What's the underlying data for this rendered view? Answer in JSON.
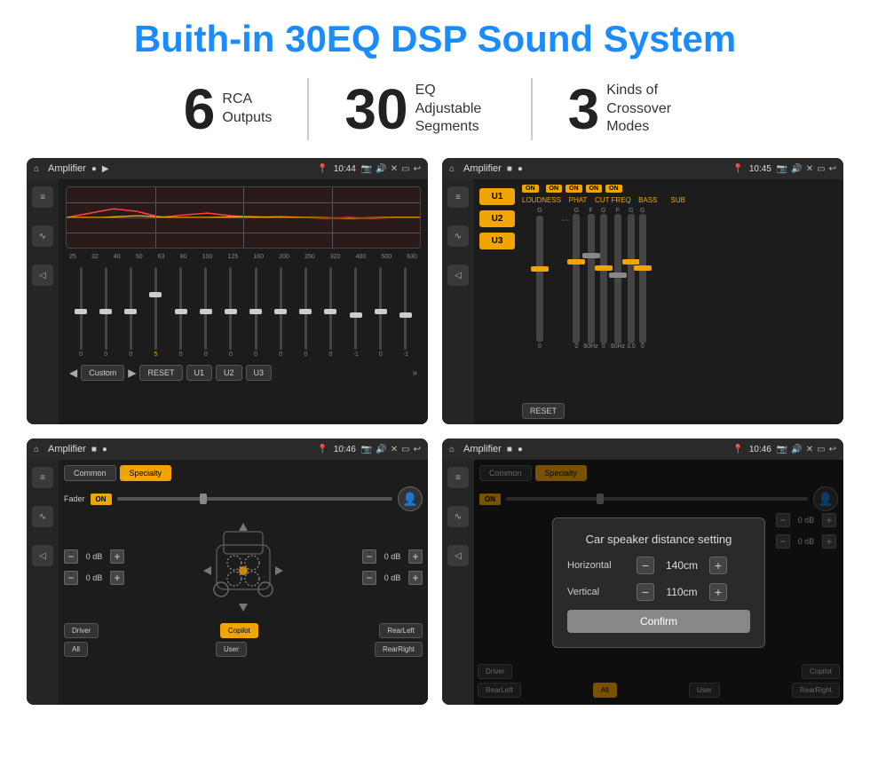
{
  "header": {
    "title": "Buith-in 30EQ DSP Sound System"
  },
  "stats": [
    {
      "number": "6",
      "label": "RCA\nOutputs"
    },
    {
      "number": "30",
      "label": "EQ Adjustable\nSegments"
    },
    {
      "number": "3",
      "label": "Kinds of\nCrossover Modes"
    }
  ],
  "screens": [
    {
      "id": "screen1",
      "topbar": {
        "title": "Amplifier",
        "time": "10:44"
      },
      "eq_frequencies": [
        "25",
        "32",
        "40",
        "50",
        "63",
        "80",
        "100",
        "125",
        "160",
        "200",
        "250",
        "320",
        "400",
        "500",
        "630"
      ],
      "eq_values": [
        "0",
        "0",
        "0",
        "5",
        "0",
        "0",
        "0",
        "0",
        "0",
        "0",
        "0",
        "-1",
        "0",
        "-1"
      ],
      "bottom_btns": [
        "Custom",
        "RESET",
        "U1",
        "U2",
        "U3"
      ]
    },
    {
      "id": "screen2",
      "topbar": {
        "title": "Amplifier",
        "time": "10:45"
      },
      "presets": [
        "U1",
        "U2",
        "U3"
      ],
      "channels": [
        {
          "name": "LOUDNESS",
          "on": true
        },
        {
          "name": "PHAT",
          "on": true
        },
        {
          "name": "CUT FREQ",
          "on": true
        },
        {
          "name": "BASS",
          "on": true
        },
        {
          "name": "SUB",
          "on": true
        }
      ],
      "reset_btn": "RESET"
    },
    {
      "id": "screen3",
      "topbar": {
        "title": "Amplifier",
        "time": "10:46"
      },
      "tabs": [
        "Common",
        "Specialty"
      ],
      "active_tab": "Specialty",
      "fader_label": "Fader",
      "fader_on": "ON",
      "controls": {
        "fl_db": "0 dB",
        "fr_db": "0 dB",
        "rl_db": "0 dB",
        "rr_db": "0 dB"
      },
      "bottom_btns": [
        "Driver",
        "Copilot",
        "RearLeft",
        "All",
        "User",
        "RearRight"
      ]
    },
    {
      "id": "screen4",
      "topbar": {
        "title": "Amplifier",
        "time": "10:46"
      },
      "tabs": [
        "Common",
        "Specialty"
      ],
      "active_tab": "Specialty",
      "dialog": {
        "title": "Car speaker distance setting",
        "horizontal_label": "Horizontal",
        "horizontal_value": "140cm",
        "vertical_label": "Vertical",
        "vertical_value": "110cm",
        "confirm_label": "Confirm"
      },
      "controls": {
        "right_db1": "0 dB",
        "right_db2": "0 dB"
      },
      "bottom_btns": [
        "Driver",
        "Copilot",
        "RearLeft",
        "All",
        "User",
        "RearRight"
      ]
    }
  ]
}
